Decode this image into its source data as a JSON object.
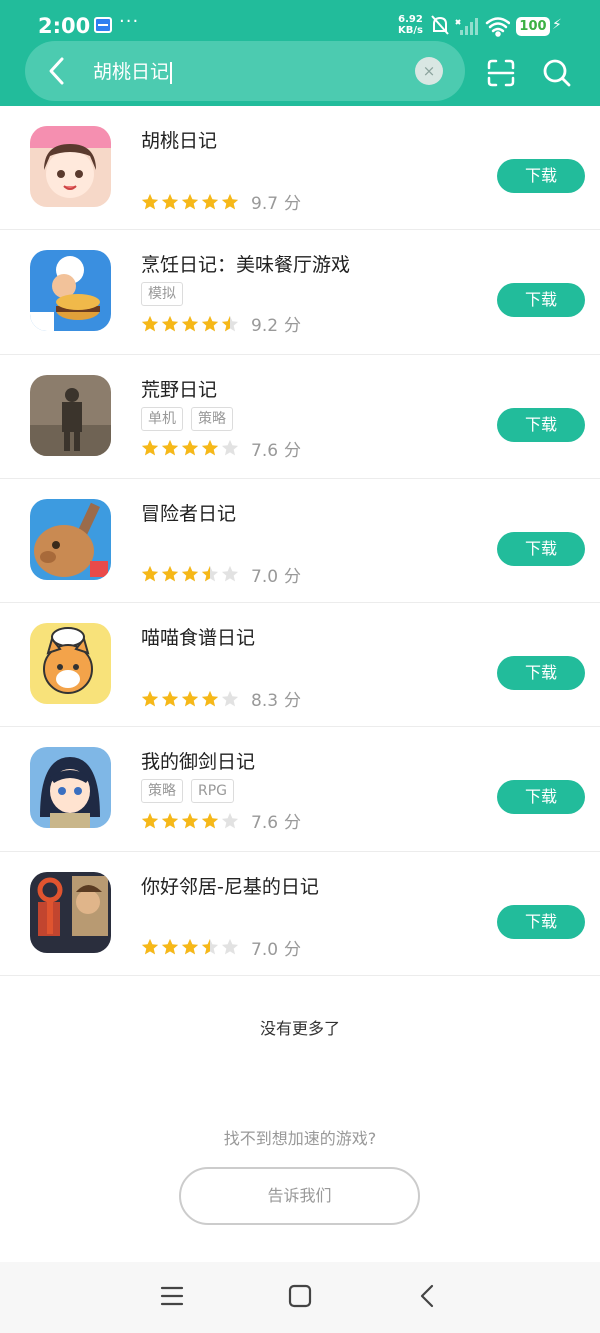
{
  "status_bar": {
    "time": "2:00",
    "dots": "···",
    "speed_value": "6.92",
    "speed_unit": "KB/s",
    "battery": "100"
  },
  "search": {
    "query": "胡桃日记",
    "clear_symbol": "×"
  },
  "list": {
    "download_label": "下载",
    "score_unit": "分",
    "items": [
      {
        "name": "胡桃日记",
        "tags": [],
        "rating": 5,
        "score": "9.7"
      },
      {
        "name": "烹饪日记：美味餐厅游戏",
        "tags": [
          "模拟"
        ],
        "rating": 4.5,
        "score": "9.2"
      },
      {
        "name": "荒野日记",
        "tags": [
          "单机",
          "策略"
        ],
        "rating": 4,
        "score": "7.6"
      },
      {
        "name": "冒险者日记",
        "tags": [],
        "rating": 3.5,
        "score": "7.0"
      },
      {
        "name": "喵喵食谱日记",
        "tags": [],
        "rating": 4,
        "score": "8.3"
      },
      {
        "name": "我的御剑日记",
        "tags": [
          "策略",
          "RPG"
        ],
        "rating": 4,
        "score": "7.6"
      },
      {
        "name": "你好邻居-尼基的日记",
        "tags": [],
        "rating": 3.5,
        "score": "7.0"
      }
    ]
  },
  "footer": {
    "no_more": "没有更多了",
    "cant_find": "找不到想加速的游戏?",
    "tell_us": "告诉我们"
  },
  "colors": {
    "accent": "#22bc9b",
    "star_on": "#f6b818",
    "star_off": "#e2e2e2"
  }
}
